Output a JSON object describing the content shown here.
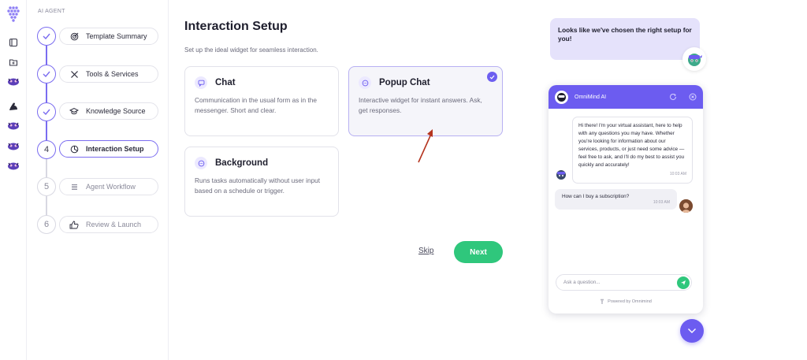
{
  "sidebar": {
    "section_label": "AI AGENT",
    "steps": [
      {
        "number": "",
        "label": "Template Summary",
        "state": "done",
        "icon": "target-icon"
      },
      {
        "number": "",
        "label": "Tools & Services",
        "state": "done",
        "icon": "tools-icon"
      },
      {
        "number": "",
        "label": "Knowledge Source",
        "state": "done",
        "icon": "graduation-cap-icon"
      },
      {
        "number": "4",
        "label": "Interaction Setup",
        "state": "active",
        "icon": "pie-chart-icon"
      },
      {
        "number": "5",
        "label": "Agent Workflow",
        "state": "todo",
        "icon": "list-icon"
      },
      {
        "number": "6",
        "label": "Review & Launch",
        "state": "todo",
        "icon": "thumbs-up-icon"
      }
    ]
  },
  "main": {
    "title": "Interaction Setup",
    "subtitle": "Set up the ideal widget for seamless interaction.",
    "options": [
      {
        "title": "Chat",
        "description": "Communication in the usual form as in the messenger. Short and clear.",
        "selected": false
      },
      {
        "title": "Popup Chat",
        "description": "Interactive widget for instant answers. Ask, get responses.",
        "selected": true
      },
      {
        "title": "Background",
        "description": "Runs tasks automatically without user input based on a schedule or trigger.",
        "selected": false
      }
    ],
    "skip_label": "Skip",
    "next_label": "Next"
  },
  "preview": {
    "hint": "Looks like we've chosen the right setup for you!",
    "widget_name": "OmniMind AI",
    "bot_message": "Hi there! I'm your virtual assistant, here to help with any questions you may have. Whether you're looking for information about our services, products, or just need some advice — feel free to ask, and I'll do my best to assist you quickly and accurately!",
    "bot_time": "10:03 AM",
    "user_message": "How can I buy a subscription?",
    "user_time": "10:03 AM",
    "input_placeholder": "Ask a question...",
    "powered_by": "Powered by Omnimind"
  },
  "colors": {
    "accent": "#6c5cf0",
    "success": "#2fc77c",
    "hint_bg": "#e5e2fb"
  }
}
